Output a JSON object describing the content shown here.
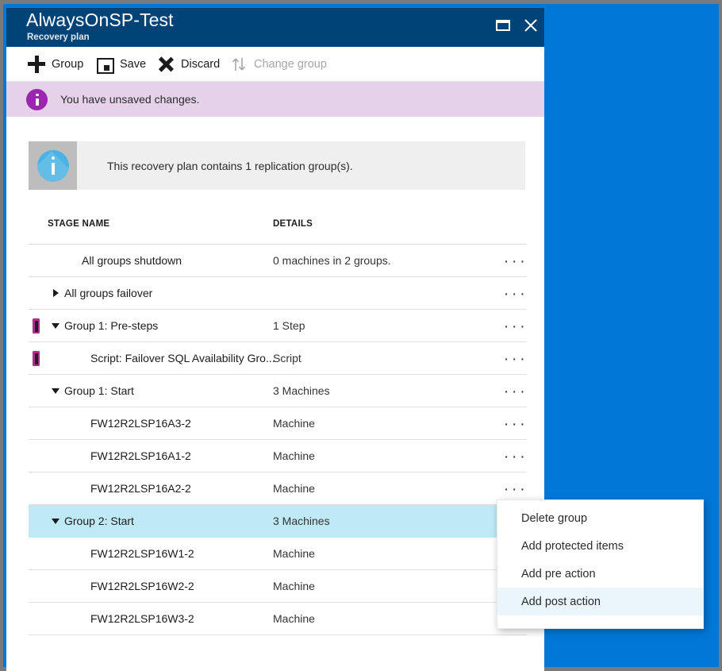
{
  "window": {
    "title": "AlwaysOnSP-Test",
    "subtitle": "Recovery plan",
    "restore_label": "restore-window",
    "close_label": "close-window",
    "accent_header": "#004376",
    "desktop_background": "#0078d7"
  },
  "commandbar": {
    "items": [
      {
        "label": "Group",
        "icon": "plus-icon",
        "disabled": false
      },
      {
        "label": "Save",
        "icon": "save-icon",
        "disabled": false
      },
      {
        "label": "Discard",
        "icon": "x-icon",
        "disabled": false
      },
      {
        "label": "Change group",
        "icon": "swap-arrows-icon",
        "disabled": true
      }
    ]
  },
  "banner": {
    "text": "You have unsaved changes.",
    "icon": "info-icon",
    "background": "#e5d1ea",
    "icon_color": "#9b27b0"
  },
  "infobox": {
    "text": "This recovery plan contains 1 replication group(s).",
    "icon": "info-icon",
    "icon_color": "#4ab3e4",
    "background": "#efefef"
  },
  "table": {
    "columns": {
      "stage": "STAGE NAME",
      "details": "DETAILS"
    },
    "overflow_glyph": "···",
    "selected_color": "#bfeaf5",
    "marker_color": "#a8308f",
    "rows": [
      {
        "stage": "All groups shutdown",
        "details": "0 machines in 2 groups.",
        "indent": 2,
        "caret": "none",
        "marker": false,
        "selected": false
      },
      {
        "stage": "All groups failover",
        "details": "",
        "indent": 1,
        "caret": "right",
        "marker": false,
        "selected": false
      },
      {
        "stage": "Group 1: Pre-steps",
        "details": "1 Step",
        "indent": 1,
        "caret": "down",
        "marker": true,
        "selected": false
      },
      {
        "stage": "Script: Failover SQL Availability Gro...",
        "details": "Script",
        "indent": 3,
        "caret": "none",
        "marker": true,
        "selected": false
      },
      {
        "stage": "Group 1: Start",
        "details": "3 Machines",
        "indent": 1,
        "caret": "down",
        "marker": false,
        "selected": false
      },
      {
        "stage": "FW12R2LSP16A3-2",
        "details": "Machine",
        "indent": 3,
        "caret": "none",
        "marker": false,
        "selected": false
      },
      {
        "stage": "FW12R2LSP16A1-2",
        "details": "Machine",
        "indent": 3,
        "caret": "none",
        "marker": false,
        "selected": false
      },
      {
        "stage": "FW12R2LSP16A2-2",
        "details": "Machine",
        "indent": 3,
        "caret": "none",
        "marker": false,
        "selected": false
      },
      {
        "stage": "Group 2: Start",
        "details": "3 Machines",
        "indent": 1,
        "caret": "down",
        "marker": false,
        "selected": true
      },
      {
        "stage": "FW12R2LSP16W1-2",
        "details": "Machine",
        "indent": 3,
        "caret": "none",
        "marker": false,
        "selected": false
      },
      {
        "stage": "FW12R2LSP16W2-2",
        "details": "Machine",
        "indent": 3,
        "caret": "none",
        "marker": false,
        "selected": false
      },
      {
        "stage": "FW12R2LSP16W3-2",
        "details": "Machine",
        "indent": 3,
        "caret": "none",
        "marker": false,
        "selected": false
      }
    ]
  },
  "context_menu": {
    "items": [
      {
        "label": "Delete group",
        "active": false
      },
      {
        "label": "Add protected items",
        "active": false
      },
      {
        "label": "Add pre action",
        "active": false
      },
      {
        "label": "Add post action",
        "active": true
      }
    ],
    "hover_color": "#eaf6fb"
  }
}
